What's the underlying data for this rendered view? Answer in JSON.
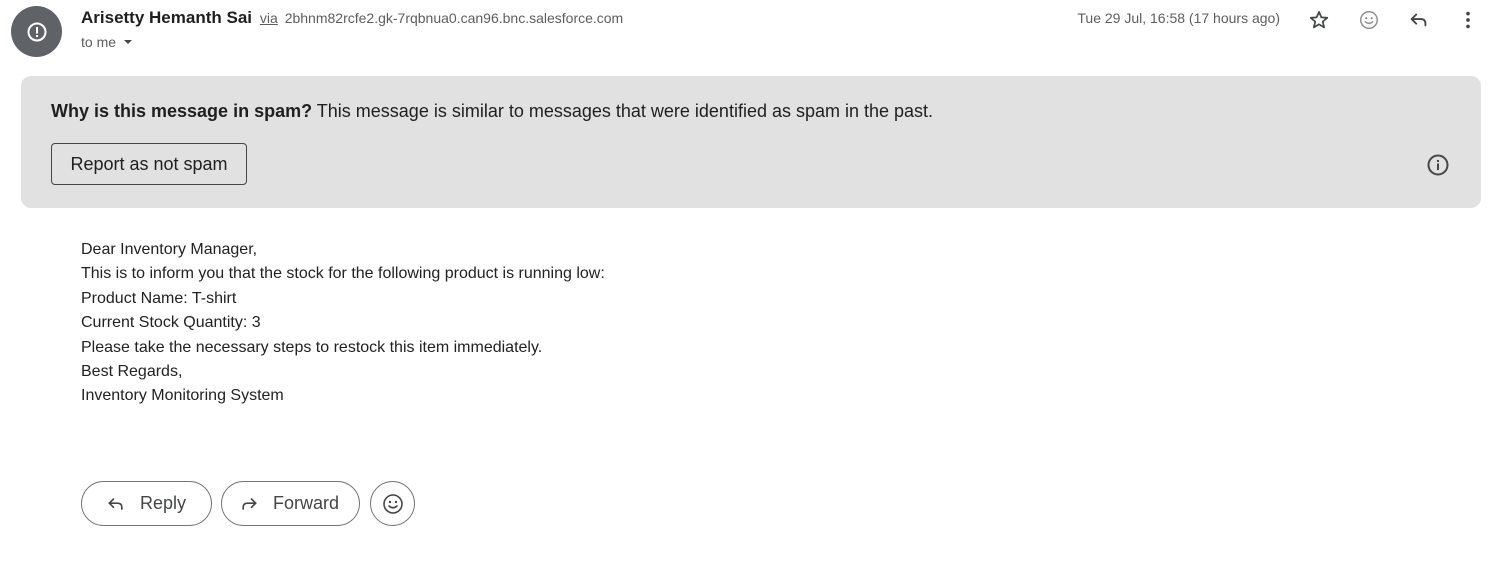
{
  "message": {
    "sender_name": "Arisetty Hemanth Sai",
    "via_label": "via",
    "sender_email": "2bhnm82rcfe2.gk-7rqbnua0.can96.bnc.salesforce.com",
    "recipient": "to me",
    "timestamp": "Tue 29 Jul, 16:58 (17 hours ago)",
    "header_icons": [
      "warning-icon",
      "star-icon",
      "emoji-icon",
      "reply-icon",
      "more-icon"
    ]
  },
  "spam_banner": {
    "question": "Why is this message in spam?",
    "explanation": "This message is similar to messages that were identified as spam in the past.",
    "button_label": "Report as not spam"
  },
  "body": {
    "lines": [
      "Dear Inventory Manager,",
      "This is to inform you that the stock for the following product is running low:",
      "Product Name: T-shirt",
      "Current Stock Quantity: 3",
      "Please take the necessary steps to restock this item immediately.",
      "Best Regards,",
      "Inventory Monitoring System"
    ]
  },
  "actions": {
    "reply_label": "Reply",
    "forward_label": "Forward"
  },
  "colors": {
    "banner_bg": "#e1e1e1",
    "avatar_bg": "#5f6368",
    "icon_gray": "#444746",
    "text_secondary": "#5e5e5e"
  }
}
